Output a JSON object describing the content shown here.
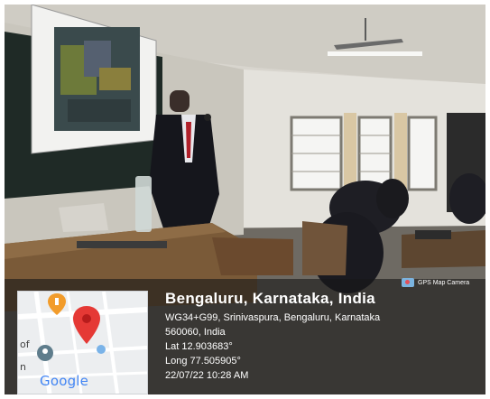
{
  "location": {
    "place": "Bengaluru, Karnataka, India",
    "address_line1": "WG34+G99, Srinivaspura, Bengaluru, Karnataka",
    "address_line2": "560060, India",
    "lat": "Lat 12.903683°",
    "long": "Long 77.505905°",
    "datetime": "22/07/22 10:28 AM"
  },
  "badge": {
    "label": "GPS Map Camera",
    "icon": "gps-camera-icon"
  },
  "map": {
    "logo": "Google",
    "edge_text_1": "of",
    "edge_text_2": "n",
    "pin_color": "#e53935",
    "icons": [
      "location-pin-icon",
      "restaurant-pin-icon",
      "place-pin-icon"
    ]
  }
}
